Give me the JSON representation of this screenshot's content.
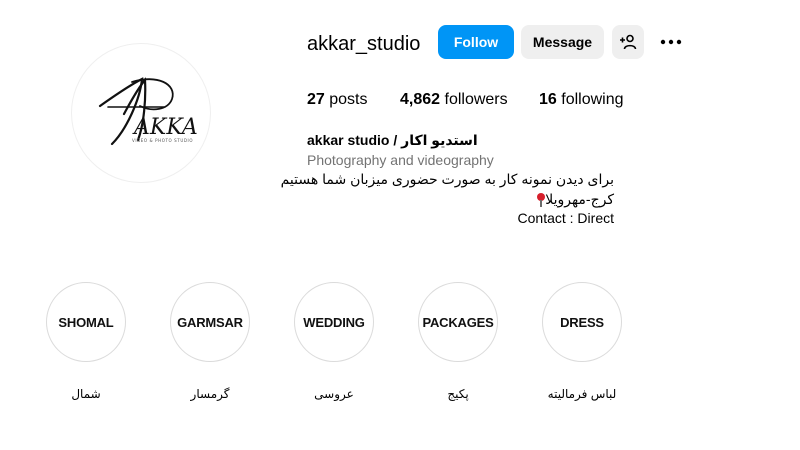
{
  "profile": {
    "username": "akkar_studio",
    "logo_text": "AKKA",
    "logo_tagline": "VIDEO & PHOTO STUDIO"
  },
  "actions": {
    "follow_label": "Follow",
    "message_label": "Message",
    "suggest_icon": "person-add-icon",
    "more_icon": "more-options-icon"
  },
  "stats": {
    "posts_count": "27",
    "posts_label": "posts",
    "followers_count": "4,862",
    "followers_label": "followers",
    "following_count": "16",
    "following_label": "following"
  },
  "bio": {
    "name": "akkar studio / استدیو اکار",
    "category": "Photography and videography",
    "line1": "برای دیدن نمونه کار به صورت حضوری میزبان شما هستیم",
    "line2": "کرج-مهرویلا",
    "line3": "Contact : Direct"
  },
  "highlights": [
    {
      "cover": "SHOMAL",
      "label": "شمال"
    },
    {
      "cover": "GARMSAR",
      "label": "گرمسار"
    },
    {
      "cover": "WEDDING",
      "label": "عروسی"
    },
    {
      "cover": "PACKAGES",
      "label": "پکیج"
    },
    {
      "cover": "DRESS",
      "label": "لباس فرمالیته"
    }
  ],
  "colors": {
    "follow_bg": "#0095f6",
    "secondary_bg": "#efefef",
    "muted_text": "#737373",
    "pin_red": "#d61f2c"
  }
}
